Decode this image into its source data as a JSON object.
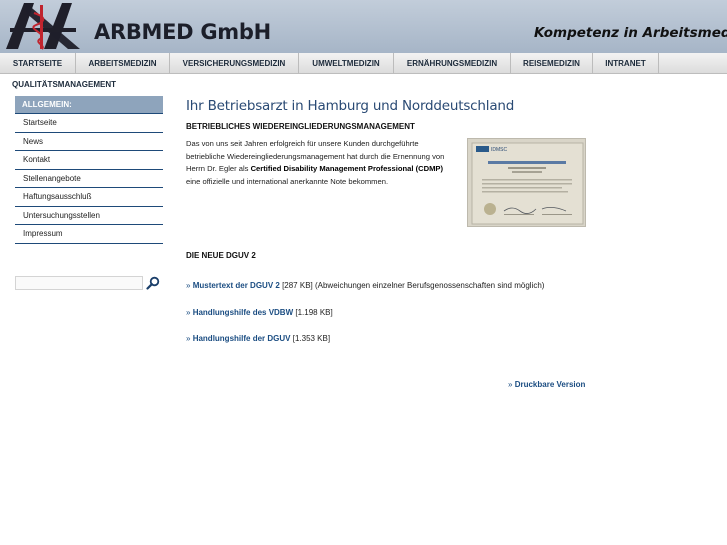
{
  "header": {
    "company": "ARBMED GmbH",
    "slogan": "Kompetenz in Arbeitsmedizin"
  },
  "nav": {
    "items": [
      "STARTSEITE",
      "ARBEITSMEDIZIN",
      "VERSICHERUNGSMEDIZIN",
      "UMWELTMEDIZIN",
      "ERNÄHRUNGSMEDIZIN",
      "REISEMEDIZIN",
      "INTRANET"
    ],
    "subnav": "QUALITÄTSMANAGEMENT"
  },
  "sidebar": {
    "heading": "ALLGEMEIN:",
    "items": [
      "Startseite",
      "News",
      "Kontakt",
      "Stellenangebote",
      "Haftungsausschluß",
      "Untersuchungsstellen",
      "Impressum"
    ]
  },
  "main": {
    "title": "Ihr Betriebsarzt in Hamburg und Norddeutschland",
    "subheading": "BETRIEBLICHES WIEDEREINGLIEDERUNGSMANAGEMENT",
    "intro_1": "Das von uns seit Jahren erfolgreich für unsere Kunden durchgeführte betriebliche Wiedereingliederungsmanagement hat durch die Ernennung von Herrn Dr. Egler als ",
    "intro_bold": "Certified Disability Management Professional (CDMP)",
    "intro_2": " eine offizielle und international anerkannte Note bekommen.",
    "certificate_label": "IDMSC",
    "dguv_heading": "DIE NEUE DGUV 2",
    "links": [
      {
        "arrow": "»",
        "label": "Mustertext der DGUV 2",
        "size": "[287 KB]",
        "note": "(Abweichungen einzelner Berufsgenossenschaften sind möglich)"
      },
      {
        "arrow": "»",
        "label": "Handlungshilfe des VDBW",
        "size": "[1.198 KB]",
        "note": ""
      },
      {
        "arrow": "»",
        "label": "Handlungshilfe der DGUV",
        "size": "[1.353 KB]",
        "note": ""
      }
    ],
    "print": {
      "arrow": "»",
      "label": "Druckbare Version"
    }
  },
  "colors": {
    "header_bg": "#b4c1d1",
    "sidebar_head_bg": "#8ea4bc",
    "link": "#1b4d82",
    "title": "#2a4a74"
  },
  "icons": {
    "logo": "caduceus-logo",
    "search": "magnifier-icon"
  }
}
